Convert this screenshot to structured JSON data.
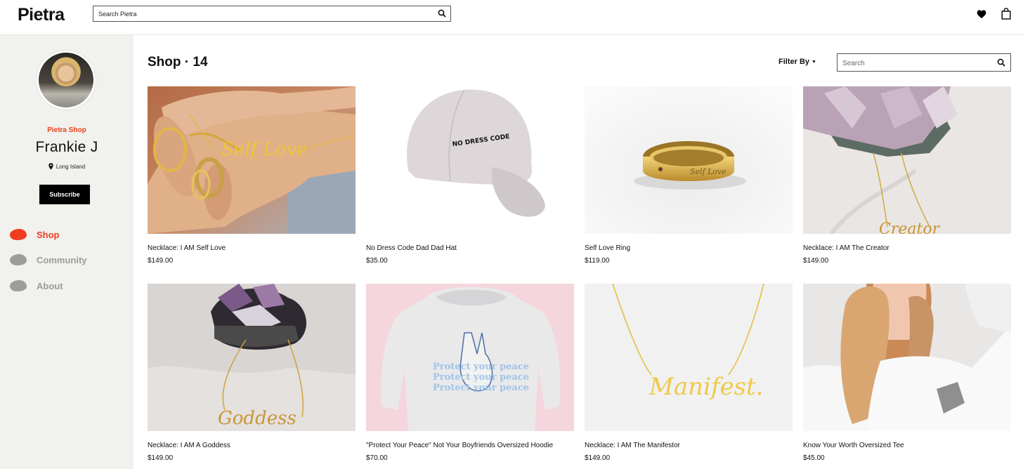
{
  "header": {
    "logo": "Pietra",
    "search_placeholder": "Search Pietra",
    "icons": [
      "search-icon",
      "heart-icon",
      "shopping-bag-icon"
    ]
  },
  "profile": {
    "shop_label": "Pietra Shop",
    "name": "Frankie J",
    "location": "Long Island",
    "subscribe_label": "Subscribe"
  },
  "nav": {
    "shop": "Shop",
    "community": "Community",
    "about": "About",
    "active_color": "#f03c1f",
    "inactive_color": "#9d9d98"
  },
  "main": {
    "title": "Shop · 14",
    "filter_label": "Filter By",
    "search_placeholder": "Search"
  },
  "products": [
    {
      "name": "Necklace: I AM Self Love",
      "price": "$149.00"
    },
    {
      "name": "No Dress Code Dad Dad Hat",
      "price": "$35.00"
    },
    {
      "name": "Self Love Ring",
      "price": "$119.00"
    },
    {
      "name": "Necklace: I AM The Creator",
      "price": "$149.00"
    },
    {
      "name": "Necklace: I AM A Goddess",
      "price": "$149.00"
    },
    {
      "name": "\"Protect Your Peace\" Not Your Boyfriends Oversized Hoodie",
      "price": "$70.00"
    },
    {
      "name": "Necklace: I AM The Manifestor",
      "price": "$149.00"
    },
    {
      "name": "Know Your Worth Oversized Tee",
      "price": "$45.00"
    }
  ],
  "product_art": {
    "necklace_script_1": "Self Love",
    "hat_text": "NO DRESS CODE",
    "ring_text": "Self Love",
    "necklace_script_4": "Creator",
    "necklace_script_5": "Goddess",
    "hoodie_text": "Protect your peace",
    "necklace_script_7": "Manifest."
  }
}
